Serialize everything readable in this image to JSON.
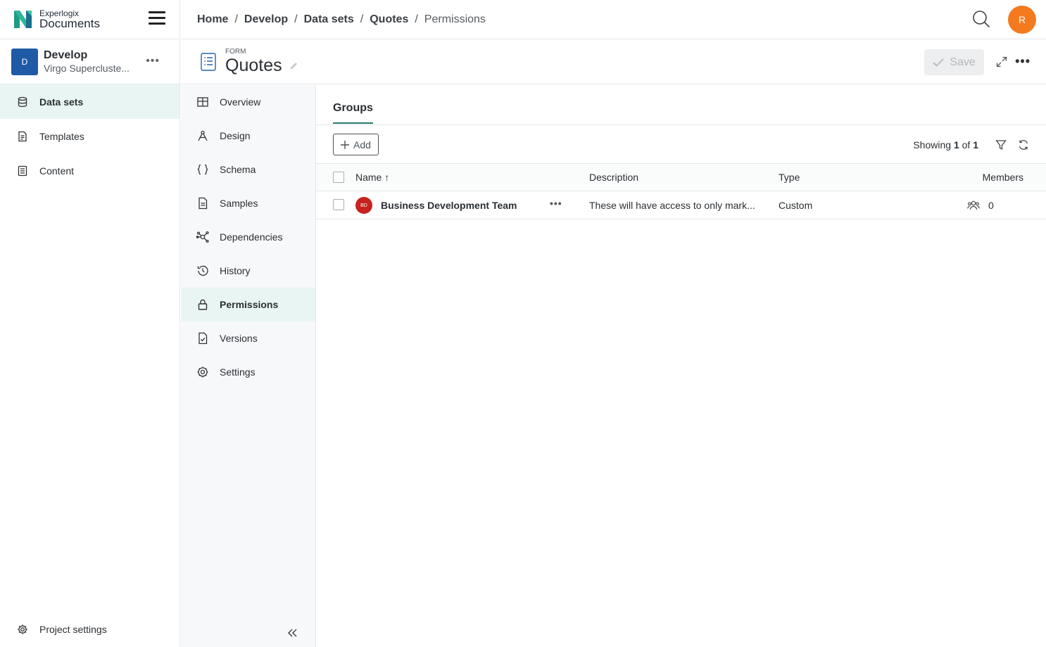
{
  "brand": {
    "top": "Experlogix",
    "bottom": "Documents"
  },
  "project": {
    "badge": "D",
    "title": "Develop",
    "subtitle": "Virgo Supercluste..."
  },
  "sidebar": {
    "items": [
      {
        "label": "Data sets",
        "icon": "database-icon",
        "active": true
      },
      {
        "label": "Templates",
        "icon": "template-icon",
        "active": false
      },
      {
        "label": "Content",
        "icon": "content-icon",
        "active": false
      }
    ],
    "footer": "Project settings"
  },
  "breadcrumb": [
    "Home",
    "Develop",
    "Data sets",
    "Quotes",
    "Permissions"
  ],
  "user": {
    "initial": "R",
    "color": "#f47a1f"
  },
  "form": {
    "label": "FORM",
    "title": "Quotes",
    "save_label": "Save"
  },
  "subnav": {
    "items": [
      {
        "label": "Overview",
        "icon": "overview-icon"
      },
      {
        "label": "Design",
        "icon": "design-icon"
      },
      {
        "label": "Schema",
        "icon": "schema-icon"
      },
      {
        "label": "Samples",
        "icon": "samples-icon"
      },
      {
        "label": "Dependencies",
        "icon": "dependencies-icon"
      },
      {
        "label": "History",
        "icon": "history-icon"
      },
      {
        "label": "Permissions",
        "icon": "lock-icon"
      },
      {
        "label": "Versions",
        "icon": "versions-icon"
      },
      {
        "label": "Settings",
        "icon": "gear-icon"
      }
    ]
  },
  "content": {
    "tab": "Groups",
    "add_label": "Add",
    "showing_prefix": "Showing",
    "showing_current": "1",
    "showing_of": "of",
    "showing_total": "1",
    "columns": {
      "name": "Name",
      "description": "Description",
      "type": "Type",
      "members": "Members"
    },
    "rows": [
      {
        "badge": "BD",
        "name": "Business Development Team",
        "description": "These will have access to only mark...",
        "type": "Custom",
        "members": "0"
      }
    ]
  },
  "colors": {
    "accent": "#1f7e6b",
    "active_bg": "#e9f5f3",
    "project_badge": "#1f5aa6",
    "group_badge": "#c6221f"
  }
}
